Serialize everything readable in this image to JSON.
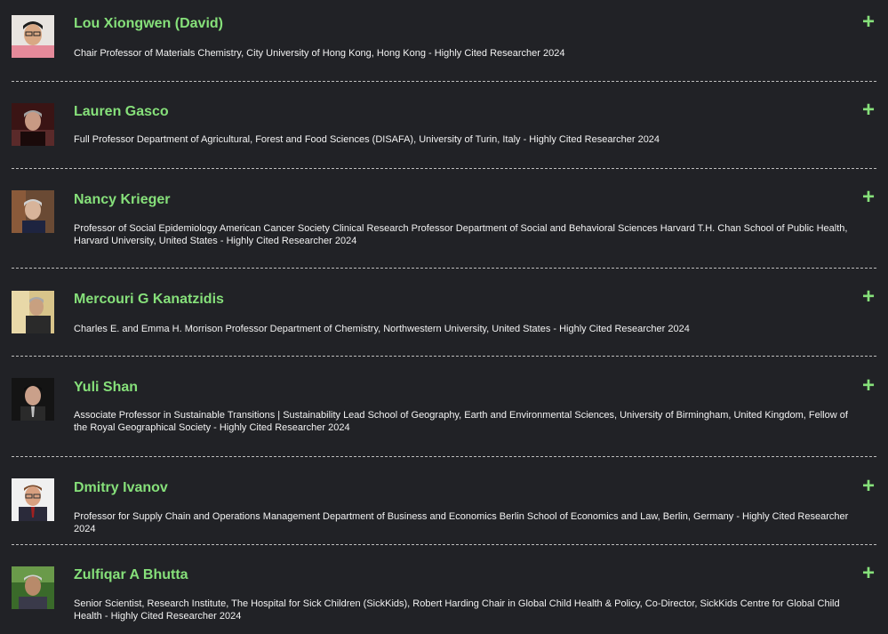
{
  "colors": {
    "background": "#212226",
    "name": "#86e07a",
    "text": "#f2f2f2",
    "divider": "#bdbdbd"
  },
  "expand_icon": "plus-icon",
  "expand_glyph": "+",
  "people": [
    {
      "name": "Lou Xiongwen (David)",
      "description": "Chair Professor of Materials Chemistry, City University of Hong Kong, Hong Kong - Highly Cited Researcher 2024"
    },
    {
      "name": "Lauren Gasco",
      "description": "Full Professor Department of Agricultural, Forest and Food Sciences (DISAFA), University of Turin, Italy - Highly Cited Researcher 2024"
    },
    {
      "name": "Nancy Krieger",
      "description": "Professor of Social Epidemiology American Cancer Society Clinical Research Professor Department of Social and Behavioral Sciences Harvard T.H. Chan School of Public Health, Harvard University, United States - Highly Cited Researcher 2024"
    },
    {
      "name": "Mercouri G Kanatzidis",
      "description": "Charles E. and Emma H. Morrison Professor Department of Chemistry, Northwestern University, United States - Highly Cited Researcher 2024"
    },
    {
      "name": "Yuli Shan",
      "description": "Associate Professor in Sustainable Transitions | Sustainability Lead School of Geography, Earth and Environmental Sciences, University of Birmingham, United Kingdom, Fellow of the Royal Geographical Society - Highly Cited Researcher 2024"
    },
    {
      "name": "Dmitry Ivanov",
      "description": "Professor for Supply Chain and Operations Management Department of Business and Economics Berlin School of Economics and Law, Berlin, Germany - Highly Cited Researcher 2024"
    },
    {
      "name": "Zulfiqar A Bhutta",
      "description": "Senior Scientist, Research Institute, The Hospital for Sick Children (SickKids), Robert Harding Chair in Global Child Health & Policy, Co-Director, SickKids Centre for Global Child Health - Highly Cited Researcher 2024"
    }
  ]
}
